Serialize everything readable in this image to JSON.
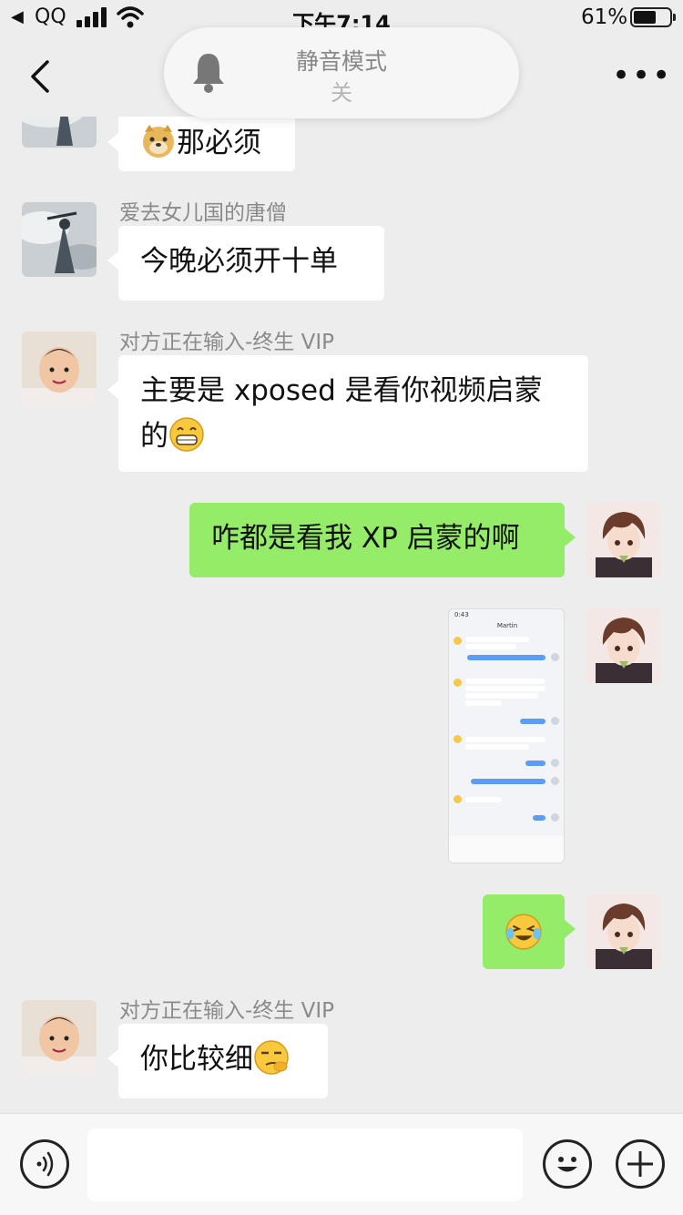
{
  "status_bar": {
    "back_app": "QQ",
    "time": "下午7:14",
    "battery": "61%"
  },
  "toast": {
    "title": "静音模式",
    "state": "关"
  },
  "messages": [
    {
      "side": "in",
      "sender": "",
      "text": "那必须",
      "emoji": "doge-emoji"
    },
    {
      "side": "in",
      "sender": "爱去女儿国的唐僧",
      "text": "今晚必须开十单"
    },
    {
      "side": "in",
      "sender": "对方正在输入-终生 VIP",
      "text_line1": "主要是 xposed 是看你视频启蒙",
      "text_line2": "的",
      "emoji": "grin-emoji"
    },
    {
      "side": "out",
      "text": "咋都是看我 XP 启蒙的啊"
    },
    {
      "side": "out",
      "type": "image",
      "image_title": "Martin",
      "image_time": "0:43"
    },
    {
      "side": "out",
      "emoji": "laugh-cry-emoji"
    },
    {
      "side": "in",
      "sender": "对方正在输入-终生 VIP",
      "text": "你比较细",
      "emoji": "smirk-emoji"
    }
  ],
  "input": {
    "placeholder": ""
  },
  "colors": {
    "background": "#ededed",
    "outgoing_bubble": "#95ec69",
    "incoming_bubble": "#ffffff"
  }
}
